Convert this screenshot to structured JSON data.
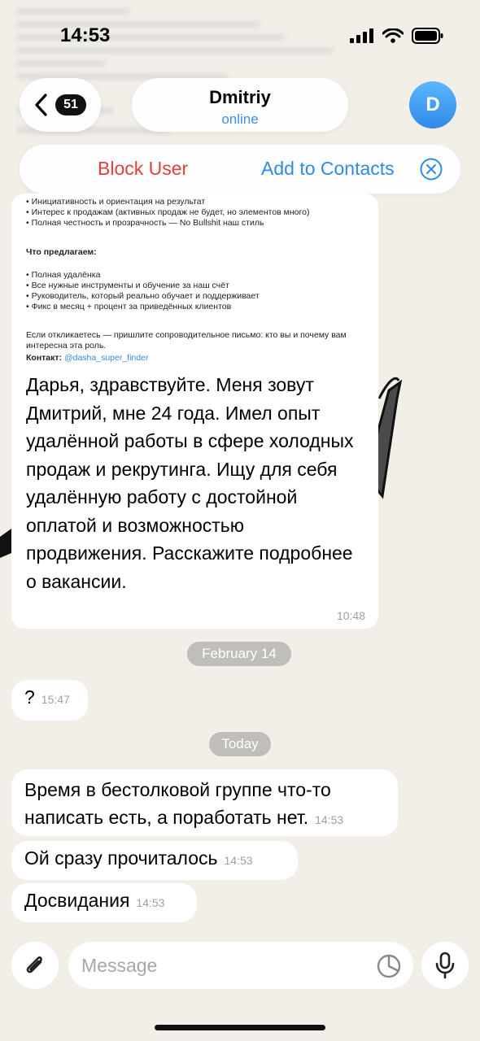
{
  "status_bar": {
    "time": "14:53"
  },
  "header": {
    "back_count": "51",
    "name": "Dmitriy",
    "status": "online",
    "avatar_letter": "D"
  },
  "action_bar": {
    "block_label": "Block User",
    "add_contacts_label": "Add to Contacts"
  },
  "quoted_post": {
    "lines_1": "• Инициативность и ориентация на результат\n• Интерес к продажам (активных продаж не будет, но элементов много)\n• Полная честность и прозрачность — No Bullshit наш стиль",
    "offer_heading": "Что предлагаем:",
    "lines_2": "• Полная удалёнка\n• Все нужные инструменты и обучение за наш счёт\n• Руководитель, который реально обучает и поддерживает\n• Фикс в месяц + процент за приведённых клиентов",
    "closing": "Если откликаетесь — пришлите сопроводительное письмо: кто вы и почему вам\nинтересна эта роль.",
    "contact_label": "Контакт:",
    "contact_handle": "@dasha_super_finder"
  },
  "messages": [
    {
      "text": "Дарья, здравствуйте. Меня зовут Дмитрий, мне 24 года. Имел опыт удалённой работы в сфере холодных продаж и рекрутинга. Ищу для себя удалённую работу с достойной оплатой и возможностью продвижения. Расскажите подробнее о вакансии.",
      "time": "10:48"
    },
    {
      "text": "?",
      "time": "15:47"
    },
    {
      "text": "Время в бестолковой группе что-то написать есть, а поработать нет.",
      "time": "14:53"
    },
    {
      "text": "Ой сразу прочиталось",
      "time": "14:53"
    },
    {
      "text": "Досвидания",
      "time": "14:53"
    }
  ],
  "date_separators": [
    "February 14",
    "Today"
  ],
  "composer": {
    "placeholder": "Message"
  },
  "colors": {
    "accent": "#2f8ae6",
    "danger": "#e0413c",
    "background": "#f2efe8"
  },
  "icons": [
    "back-chevron-icon",
    "signal-icon",
    "wifi-icon",
    "battery-icon",
    "close-circle-icon",
    "paperclip-icon",
    "sticker-icon",
    "microphone-icon"
  ]
}
